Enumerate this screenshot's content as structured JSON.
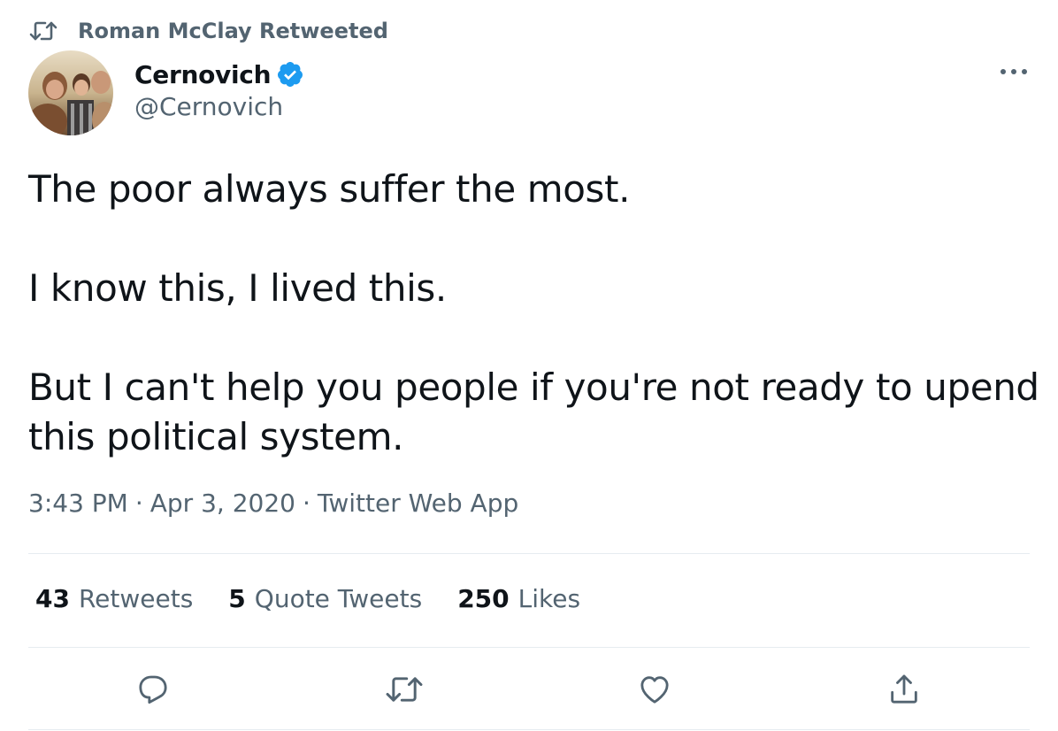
{
  "retweet_context": {
    "icon": "retweet-icon",
    "label": "Roman McClay Retweeted"
  },
  "author": {
    "display_name": "Cernovich",
    "handle": "@Cernovich",
    "verified": true,
    "verified_color": "#1d9bf0"
  },
  "tweet": {
    "paragraphs": [
      [
        "The poor always suffer the most."
      ],
      [
        "I know this, I lived this."
      ],
      [
        "But I can't help you people if you're not ready to upend",
        "this political system."
      ]
    ]
  },
  "meta": {
    "time": "3:43 PM",
    "separator": "·",
    "date": "Apr 3, 2020",
    "source": "Twitter Web App"
  },
  "stats": {
    "retweets": {
      "count": "43",
      "label": "Retweets"
    },
    "quote_tweets": {
      "count": "5",
      "label": "Quote Tweets"
    },
    "likes": {
      "count": "250",
      "label": "Likes"
    }
  },
  "actions": [
    "reply-icon",
    "retweet-icon",
    "like-icon",
    "share-icon"
  ],
  "colors": {
    "text": "#0f1419",
    "secondary": "#536471",
    "divider": "#e6ecf0"
  }
}
